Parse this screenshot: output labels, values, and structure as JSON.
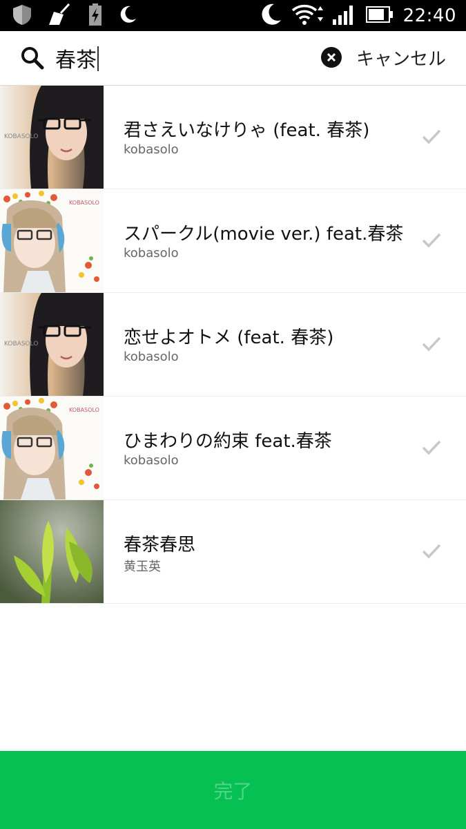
{
  "status_bar": {
    "time": "22:40",
    "left_icons": [
      "shield-icon",
      "broom-icon",
      "battery-charging-icon",
      "moon-icon"
    ],
    "right_icons": [
      "moon-icon",
      "wifi-icon",
      "signal-icon",
      "battery-icon"
    ]
  },
  "search": {
    "icon": "search-icon",
    "query": "春茶",
    "clear_icon": "clear-icon",
    "cancel_label": "キャンセル"
  },
  "results": [
    {
      "title": "君さえいなけりゃ (feat. 春茶)",
      "artist": "kobasolo",
      "thumb_text": "KOBASOLO",
      "check_icon": "check-icon"
    },
    {
      "title": "スパークル(movie ver.) feat.春茶",
      "artist": "kobasolo",
      "thumb_text": "KOBASOLO",
      "check_icon": "check-icon"
    },
    {
      "title": "恋せよオトメ (feat. 春茶)",
      "artist": "kobasolo",
      "thumb_text": "KOBASOLO",
      "check_icon": "check-icon"
    },
    {
      "title": "ひまわりの約束 feat.春茶",
      "artist": "kobasolo",
      "thumb_text": "KOBASOLO",
      "check_icon": "check-icon"
    },
    {
      "title": "春茶春思",
      "artist": "黄玉英",
      "check_icon": "check-icon"
    }
  ],
  "done_button": {
    "label": "完了"
  },
  "colors": {
    "accent": "#06c152",
    "done_text": "#4fd588",
    "check": "#c8c8c8"
  }
}
